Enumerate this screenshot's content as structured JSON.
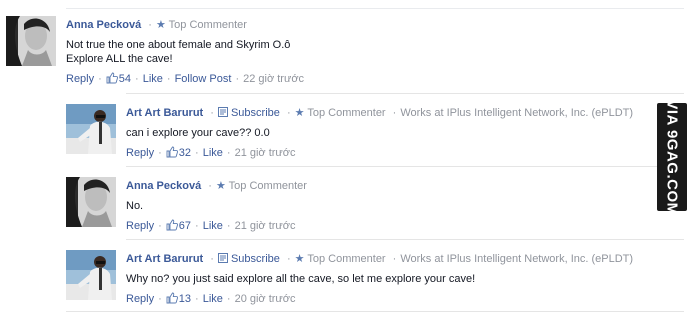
{
  "comments": [
    {
      "name": "Anna Pecková",
      "badge": "Top Commenter",
      "text": "Not true the one about female and Skyrim O.ô\nExplore ALL the cave!",
      "reply": "Reply",
      "likes": "54",
      "like": "Like",
      "follow": "Follow Post",
      "time": "22 giờ trước"
    },
    {
      "name": "Art Art Barurut",
      "subscribe": "Subscribe",
      "badge": "Top Commenter",
      "work": "Works at IPlus Intelligent Network, Inc. (ePLDT)",
      "text": "can i explore your cave?? 0.0",
      "reply": "Reply",
      "likes": "32",
      "like": "Like",
      "time": "21 giờ trước"
    },
    {
      "name": "Anna Pecková",
      "badge": "Top Commenter",
      "text": "No.",
      "reply": "Reply",
      "likes": "67",
      "like": "Like",
      "time": "21 giờ trước"
    },
    {
      "name": "Art Art Barurut",
      "subscribe": "Subscribe",
      "badge": "Top Commenter",
      "work": "Works at IPlus Intelligent Network, Inc. (ePLDT)",
      "text": "Why no? you just said explore all the cave, so let me explore your cave!",
      "reply": "Reply",
      "likes": "13",
      "like": "Like",
      "time": "20 giờ trước"
    }
  ],
  "watermark": "VIA 9GAG.COM",
  "colors": {
    "link": "#3b5998",
    "meta": "#90949c",
    "watermark_bg": "#1a1a1a"
  }
}
